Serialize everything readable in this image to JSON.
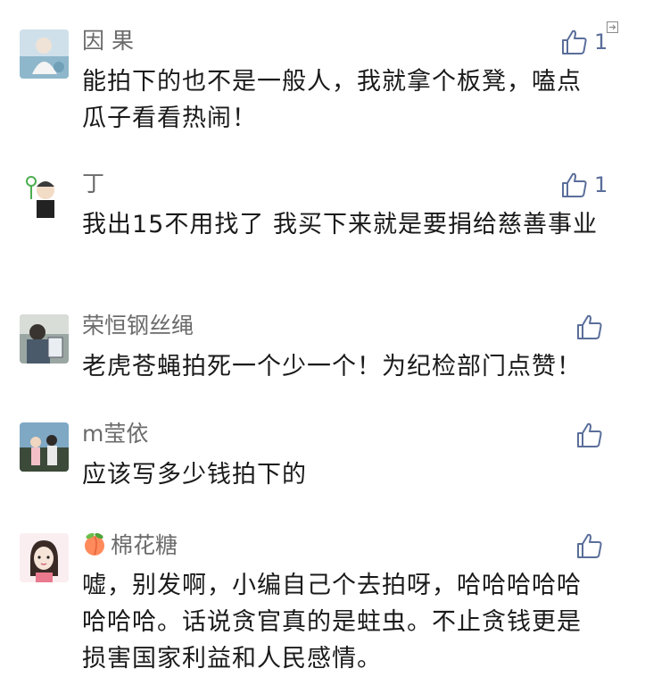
{
  "colors": {
    "like_blue": "#5a6e9a",
    "name_gray": "#6b6b6b",
    "text_dark": "#1a1a1a"
  },
  "comments": [
    {
      "name": "因 果",
      "content": "能拍下的也不是一般人，我就拿个板凳，嗑点瓜子看看热闹！",
      "likes": "1"
    },
    {
      "name": "丁",
      "content": "我出15不用找了 我买下来就是要捐给慈善事业",
      "likes": "1"
    },
    {
      "name": "荣恒钢丝绳",
      "content": "老虎苍蝇拍死一个少一个！为纪检部门点赞！",
      "likes": ""
    },
    {
      "name": "m莹依",
      "content": "应该写多少钱拍下的",
      "likes": ""
    },
    {
      "name": "棉花糖",
      "name_emoji": "peach-icon",
      "content": "嘘，别发啊，小编自己个去拍呀，哈哈哈哈哈哈哈哈。话说贪官真的是蛀虫。不止贪钱更是损害国家利益和人民感情。",
      "likes": ""
    }
  ]
}
